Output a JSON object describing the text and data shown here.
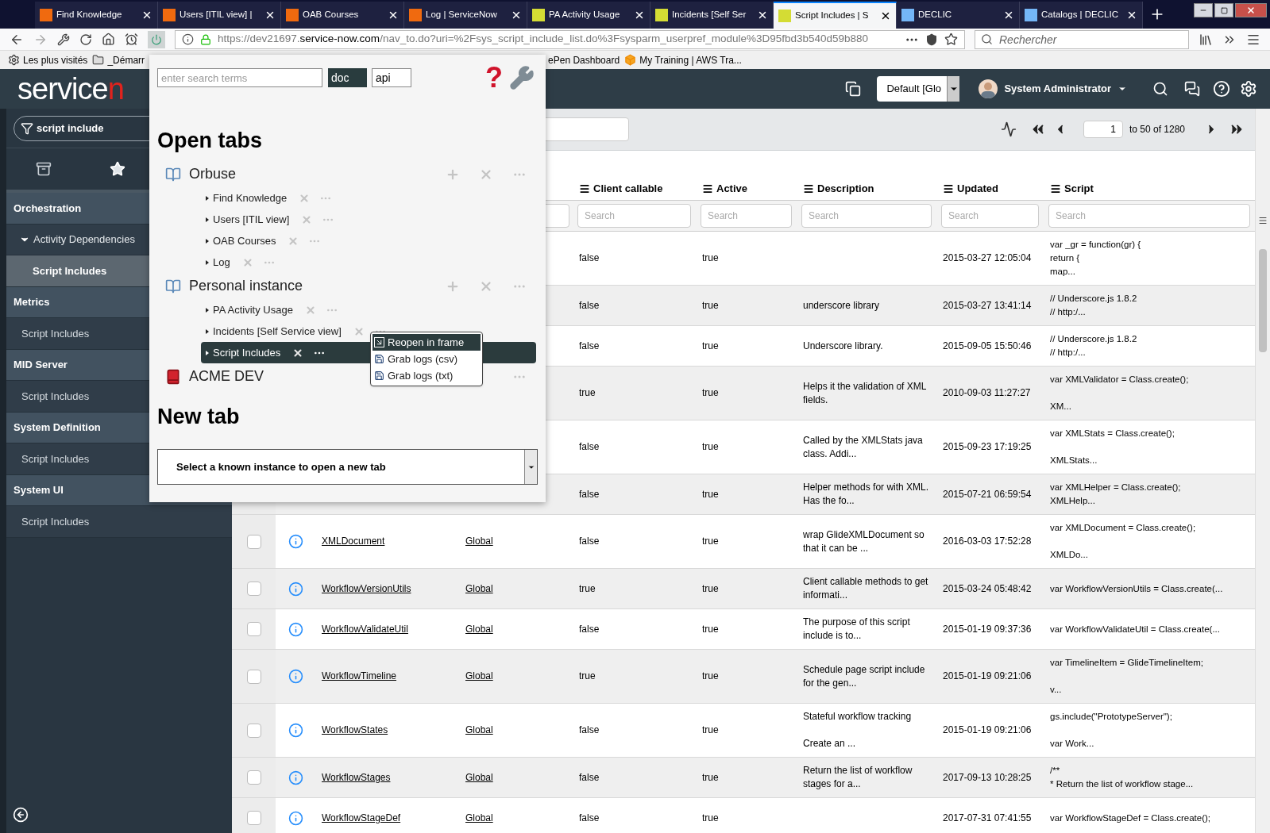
{
  "browser": {
    "tabs": [
      {
        "label": "Find Knowledge",
        "color": "#f06a0f",
        "selected": false
      },
      {
        "label": "Users [ITIL view] |",
        "color": "#f06a0f",
        "selected": false
      },
      {
        "label": "OAB Courses",
        "color": "#f06a0f",
        "selected": false
      },
      {
        "label": "Log | ServiceNow",
        "color": "#f06a0f",
        "selected": false
      },
      {
        "label": "PA Activity Usage",
        "color": "#d4dc34",
        "selected": false
      },
      {
        "label": "Incidents [Self Ser",
        "color": "#d4dc34",
        "selected": false
      },
      {
        "label": "Script Includes | S",
        "color": "#d4dc34",
        "selected": true
      },
      {
        "label": "DECLIC",
        "color": "#74b6f7",
        "selected": false
      },
      {
        "label": "Catalogs | DECLIC",
        "color": "#74b6f7",
        "selected": false
      }
    ],
    "url": {
      "scheme": "https://dev21697.",
      "domain": "service-now.com",
      "path": "/nav_to.do?uri=%2Fsys_script_include_list.do%3Fsysparm_userpref_module%3D95fbd3b540d59b880"
    },
    "search_placeholder": "Rechercher",
    "bookmarks_left": [
      {
        "label": "Les plus visités",
        "kind": "gear"
      },
      {
        "label": "_Démarr",
        "kind": "folder"
      }
    ],
    "bookmarks_right": [
      {
        "label": "ePen Dashboard",
        "kind": "none"
      },
      {
        "label": "My Training | AWS Tra...",
        "kind": "cube"
      }
    ]
  },
  "header": {
    "logo_main": "service",
    "logo_accent": "n",
    "scope": "Default [Glo",
    "user": "System Administrator"
  },
  "sidebar": {
    "filter": "script include",
    "items": [
      {
        "label": "Orchestration",
        "kind": "section",
        "selected": false
      },
      {
        "label": "Activity Dependencies",
        "kind": "folder",
        "selected": false,
        "expanded": true
      },
      {
        "label": "Script Includes",
        "kind": "subitem",
        "selected": true
      },
      {
        "label": "Metrics",
        "kind": "section",
        "selected": false
      },
      {
        "label": "Script Includes",
        "kind": "item",
        "selected": false
      },
      {
        "label": "MID Server",
        "kind": "section",
        "selected": false
      },
      {
        "label": "Script Includes",
        "kind": "item",
        "selected": false
      },
      {
        "label": "System Definition",
        "kind": "section",
        "selected": false
      },
      {
        "label": "Script Includes",
        "kind": "item",
        "selected": false
      },
      {
        "label": "System UI",
        "kind": "section",
        "selected": false
      },
      {
        "label": "Script Includes",
        "kind": "item",
        "selected": false
      }
    ]
  },
  "list": {
    "page": "1",
    "range": "to 50 of 1280",
    "columns": [
      {
        "label": "Client callable",
        "placeholder": "Search"
      },
      {
        "label": "Active",
        "placeholder": "Search"
      },
      {
        "label": "Description",
        "placeholder": "Search"
      },
      {
        "label": "Updated",
        "placeholder": "Search"
      },
      {
        "label": "Script",
        "placeholder": "Search"
      }
    ],
    "rows": [
      {
        "client_callable": "false",
        "active": "true",
        "updated": "2015-03-27 12:05:04",
        "script": "var _gr = function(gr) {\nreturn {\nmap..."
      },
      {
        "client_callable": "false",
        "active": "true",
        "description": "underscore library",
        "updated": "2015-03-27 13:41:14",
        "script": "// Underscore.js 1.8.2\n// http:/..."
      },
      {
        "client_callable": "false",
        "active": "true",
        "description": "Underscore library.",
        "updated": "2015-09-05 15:50:46",
        "script": "// Underscore.js 1.8.2\n// http:/..."
      },
      {
        "client_callable": "true",
        "active": "true",
        "description": "Helps it the validation of XML fields.",
        "updated": "2010-09-03 11:27:27",
        "script": "var XMLValidator = Class.create();\n\nXM..."
      },
      {
        "client_callable": "false",
        "active": "true",
        "description": "Called by the XMLStats java class. Addi...",
        "updated": "2015-09-23 17:19:25",
        "script": "var XMLStats = Class.create();\n\nXMLStats..."
      },
      {
        "client_callable": "false",
        "active": "true",
        "description": "Helper methods for with XML. Has the fo...",
        "updated": "2015-07-21 06:59:54",
        "script": "var XMLHelper = Class.create();\nXMLHelp..."
      },
      {
        "checked": false,
        "name": "XMLDocument",
        "application": "Global",
        "client_callable": "false",
        "active": "true",
        "description": "wrap GlideXMLDocument so that it can be ...",
        "updated": "2016-03-03 17:52:28",
        "script": "var XMLDocument = Class.create();\n\nXMLDo..."
      },
      {
        "checked": false,
        "name": "WorkflowVersionUtils",
        "application": "Global",
        "client_callable": "true",
        "active": "true",
        "description": "Client callable methods to get informati...",
        "updated": "2015-03-24 05:48:42",
        "script": "var WorkflowVersionUtils = Class.create(..."
      },
      {
        "checked": false,
        "name": "WorkflowValidateUtil",
        "application": "Global",
        "client_callable": "false",
        "active": "true",
        "description": "The purpose of this script include is to...",
        "updated": "2015-01-19 09:37:36",
        "script": "var WorkflowValidateUtil = Class.create(..."
      },
      {
        "checked": false,
        "name": "WorkflowTimeline",
        "application": "Global",
        "client_callable": "true",
        "active": "true",
        "description": "Schedule page script include for the gen...",
        "updated": "2015-01-19 09:21:06",
        "script": "var TimelineItem = GlideTimelineItem;\n\nv..."
      },
      {
        "checked": false,
        "name": "WorkflowStates",
        "application": "Global",
        "client_callable": "false",
        "active": "true",
        "description": "Stateful workflow tracking\n\nCreate an ...",
        "updated": "2015-01-19 09:21:06",
        "script": "gs.include(\"PrototypeServer\");\n\nvar Work..."
      },
      {
        "checked": false,
        "name": "WorkflowStages",
        "application": "Global",
        "client_callable": "false",
        "active": "true",
        "description": "Return the list of workflow stages for a...",
        "updated": "2017-09-13 10:28:25",
        "script": "/**\n* Return the list of workflow stage..."
      },
      {
        "checked": false,
        "name": "WorkflowStageDef",
        "application": "Global",
        "client_callable": "false",
        "active": "true",
        "updated": "2017-07-31 07:41:55",
        "script": "var WorkflowStageDef = Class.create();"
      }
    ]
  },
  "popup": {
    "search_placeholder": "enter search terms",
    "doc_button": "doc",
    "api_field": "api",
    "help_mark": "?",
    "open_tabs_title": "Open tabs",
    "groups": [
      {
        "name": "Orbuse",
        "kind": "blue",
        "actions": true,
        "tabs": [
          {
            "label": "Find Knowledge",
            "selected": false
          },
          {
            "label": "Users [ITIL view]",
            "selected": false
          },
          {
            "label": "OAB Courses",
            "selected": false
          },
          {
            "label": "Log",
            "selected": false
          }
        ]
      },
      {
        "name": "Personal instance",
        "kind": "blue",
        "actions": true,
        "tabs": [
          {
            "label": "PA Activity Usage",
            "selected": false
          },
          {
            "label": "Incidents [Self Service view]",
            "selected": false
          },
          {
            "label": "Script Includes",
            "selected": true
          }
        ]
      },
      {
        "name": "ACME DEV",
        "kind": "red",
        "actions": false
      }
    ],
    "menu": [
      {
        "label": "Reopen in frame",
        "kind": "reopen",
        "selected": true
      },
      {
        "label": "Grab logs (csv)",
        "kind": "save",
        "selected": false
      },
      {
        "label": "Grab logs (txt)",
        "kind": "save",
        "selected": false
      }
    ],
    "new_tab_title": "New tab",
    "instance_select": "Select a known instance to open a new tab"
  }
}
